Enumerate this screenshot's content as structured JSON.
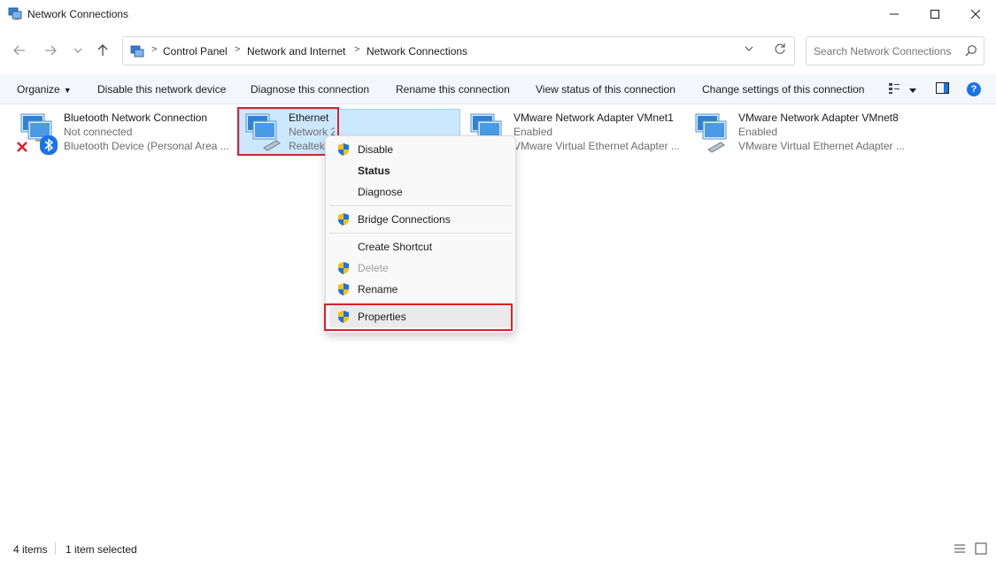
{
  "window": {
    "title": "Network Connections",
    "minimize": "—",
    "maximize": "☐",
    "close": "✕"
  },
  "nav": {
    "back": "←",
    "forward": "→",
    "recent": "⌄",
    "up": "↑"
  },
  "breadcrumb": {
    "items": [
      "Control Panel",
      "Network and Internet",
      "Network Connections"
    ],
    "separator": ">"
  },
  "search": {
    "placeholder": "Search Network Connections"
  },
  "toolbar": {
    "organize": "Organize",
    "disable": "Disable this network device",
    "diagnose": "Diagnose this connection",
    "rename": "Rename this connection",
    "view_status": "View status of this connection",
    "change_settings": "Change settings of this connection",
    "help": "?"
  },
  "connections": [
    {
      "name": "Bluetooth Network Connection",
      "status": "Not connected",
      "device": "Bluetooth Device (Personal Area ..."
    },
    {
      "name": "Ethernet",
      "status": "Network 2",
      "device": "Realtek"
    },
    {
      "name": "VMware Network Adapter VMnet1",
      "status": "Enabled",
      "device": "VMware Virtual Ethernet Adapter ..."
    },
    {
      "name": "VMware Network Adapter VMnet8",
      "status": "Enabled",
      "device": "VMware Virtual Ethernet Adapter ..."
    }
  ],
  "context_menu": {
    "disable": "Disable",
    "status": "Status",
    "diagnose": "Diagnose",
    "bridge": "Bridge Connections",
    "shortcut": "Create Shortcut",
    "delete": "Delete",
    "rename": "Rename",
    "properties": "Properties"
  },
  "status_bar": {
    "count": "4 items",
    "selected": "1 item selected"
  },
  "colors": {
    "accent": "#1a73e8",
    "selection": "#cce8ff",
    "annotation_red": "#d9232e"
  }
}
